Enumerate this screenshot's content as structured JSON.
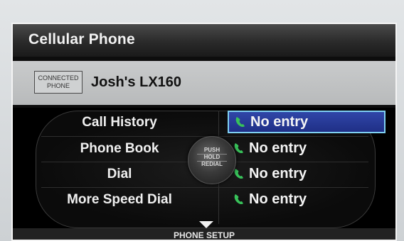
{
  "screen": {
    "title": "Cellular Phone"
  },
  "connected": {
    "badge_line1": "CONNECTED",
    "badge_line2": "PHONE",
    "device_name": "Josh's LX160"
  },
  "menu": {
    "items": [
      {
        "label": "Call History",
        "value": "No entry",
        "selected": true
      },
      {
        "label": "Phone Book",
        "value": "No entry",
        "selected": false
      },
      {
        "label": "Dial",
        "value": "No entry",
        "selected": false
      },
      {
        "label": "More Speed Dial",
        "value": "No entry",
        "selected": false
      }
    ]
  },
  "knob": {
    "line1": "PUSH",
    "line2": "HOLD",
    "line3": "REDIAL"
  },
  "footer": {
    "setup_label": "PHONE SETUP"
  },
  "colors": {
    "selected_bg": "#2a3d9e",
    "selected_border": "#7fd0f2",
    "phone_icon": "#38c25a"
  },
  "icons": {
    "entry": "phone-handset-icon",
    "scroll": "down-arrow-icon"
  }
}
